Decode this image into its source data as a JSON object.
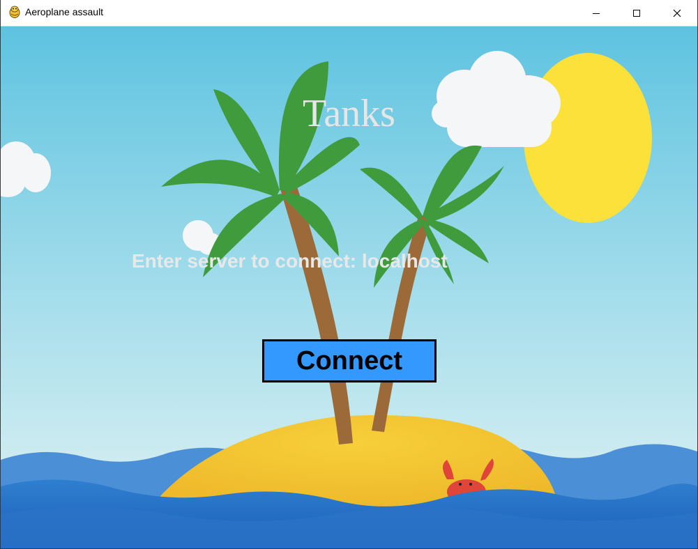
{
  "window": {
    "title": "Aeroplane assault",
    "icon": "pygame-snake-icon",
    "controls": [
      "minimize",
      "maximize",
      "close"
    ]
  },
  "game": {
    "heading": "Tanks",
    "prompt": "Enter server to connect: localhost",
    "connect_label": "Connect"
  },
  "colors": {
    "button_fill": "#3399ff",
    "button_border": "#000000",
    "heading_text": "#e6e6e6",
    "prompt_text": "#e8e8e8",
    "sky_top": "#5ec3e0",
    "sky_bottom": "#dff1f3"
  }
}
